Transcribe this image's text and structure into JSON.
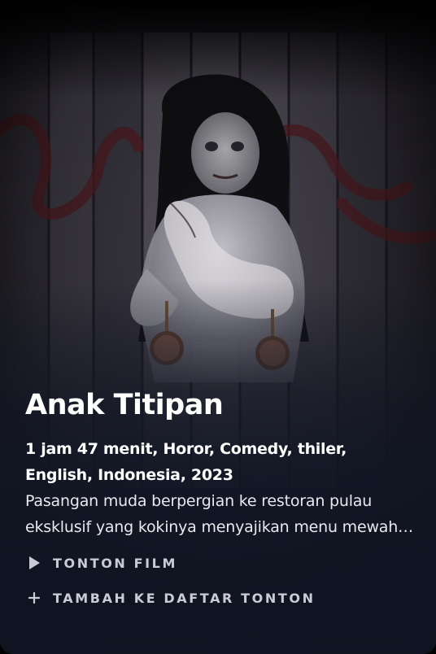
{
  "movie": {
    "title": "Anak Titipan",
    "meta": "1 jam 47 menit, Horor, Comedy, thiler, English, Indonesia, 2023",
    "description": "Pasangan muda berpergian ke restoran pulau eksklusif yang kokinya menyajikan menu mewah dengan kejutan mengejutkan."
  },
  "actions": {
    "watch_label": "TONTON FILM",
    "watch_icon": "play-icon",
    "add_label": "TAMBAH KE DAFTAR TONTON",
    "add_icon": "plus-icon"
  },
  "colors": {
    "background": "#1a1c26",
    "text": "#ffffff",
    "action_text": "#c9ccd6"
  }
}
